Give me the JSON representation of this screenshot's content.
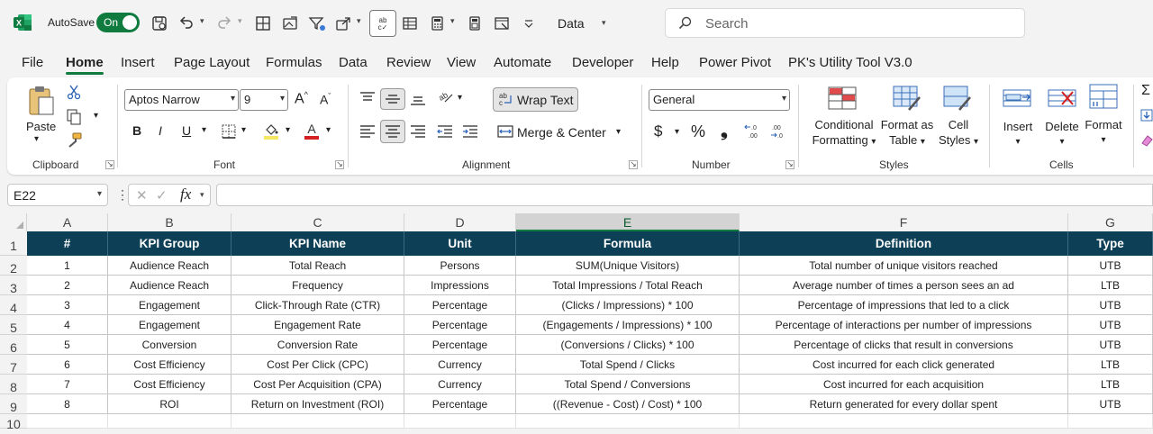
{
  "titlebar": {
    "app_icon": "excel-icon",
    "autosave_label": "AutoSave",
    "autosave_state": "On",
    "data_label": "Data",
    "search_placeholder": "Search"
  },
  "menu": {
    "tabs": [
      "File",
      "Home",
      "Insert",
      "Page Layout",
      "Formulas",
      "Data",
      "Review",
      "View",
      "Automate",
      "Developer",
      "Help",
      "Power Pivot",
      "PK's Utility Tool V3.0"
    ],
    "active": "Home"
  },
  "ribbon": {
    "clipboard": {
      "paste_label": "Paste",
      "group_label": "Clipboard"
    },
    "font": {
      "font_name": "Aptos Narrow",
      "font_size": "9",
      "grow": "A",
      "shrink": "A",
      "bold": "B",
      "italic": "I",
      "underline": "U",
      "group_label": "Font"
    },
    "alignment": {
      "wrap_text": "Wrap Text",
      "merge_center": "Merge & Center",
      "group_label": "Alignment"
    },
    "number": {
      "format": "General",
      "currency": "$",
      "percent": "%",
      "comma": "❟",
      "inc_decimal": "←.0\n.00",
      "dec_decimal": ".00\n→.0",
      "group_label": "Number"
    },
    "styles": {
      "conditional_formatting": [
        "Conditional",
        "Formatting"
      ],
      "format_as_table": [
        "Format as",
        "Table"
      ],
      "cell_styles": [
        "Cell",
        "Styles"
      ],
      "group_label": "Styles"
    },
    "cells": {
      "insert": "Insert",
      "delete": "Delete",
      "format": "Format",
      "group_label": "Cells"
    }
  },
  "formula_bar": {
    "name_box": "E22",
    "fx": "fx",
    "formula": ""
  },
  "sheet": {
    "columns": [
      "A",
      "B",
      "C",
      "D",
      "E",
      "F",
      "G"
    ],
    "selected_column": "E",
    "rows": [
      "1",
      "2",
      "3",
      "4",
      "5",
      "6",
      "7",
      "8",
      "9",
      "10"
    ],
    "headers": [
      "#",
      "KPI Group",
      "KPI Name",
      "Unit",
      "Formula",
      "Definition",
      "Type"
    ],
    "data": [
      [
        "1",
        "Audience Reach",
        "Total Reach",
        "Persons",
        "SUM(Unique Visitors)",
        "Total number of unique visitors reached",
        "UTB"
      ],
      [
        "2",
        "Audience Reach",
        "Frequency",
        "Impressions",
        "Total Impressions / Total Reach",
        "Average number of times a person sees an ad",
        "LTB"
      ],
      [
        "3",
        "Engagement",
        "Click-Through Rate (CTR)",
        "Percentage",
        "(Clicks / Impressions) * 100",
        "Percentage of impressions that led to a click",
        "UTB"
      ],
      [
        "4",
        "Engagement",
        "Engagement Rate",
        "Percentage",
        "(Engagements / Impressions) * 100",
        "Percentage of interactions per number of impressions",
        "UTB"
      ],
      [
        "5",
        "Conversion",
        "Conversion Rate",
        "Percentage",
        "(Conversions / Clicks) * 100",
        "Percentage of clicks that result in conversions",
        "UTB"
      ],
      [
        "6",
        "Cost Efficiency",
        "Cost Per Click (CPC)",
        "Currency",
        "Total Spend / Clicks",
        "Cost incurred for each click generated",
        "LTB"
      ],
      [
        "7",
        "Cost Efficiency",
        "Cost Per Acquisition (CPA)",
        "Currency",
        "Total Spend / Conversions",
        "Cost incurred for each acquisition",
        "LTB"
      ],
      [
        "8",
        "ROI",
        "Return on Investment (ROI)",
        "Percentage",
        "((Revenue - Cost) / Cost) * 100",
        "Return generated for every dollar spent",
        "UTB"
      ]
    ]
  },
  "colors": {
    "header_fill": "#0d3f57",
    "accent": "#0f7b3e"
  }
}
